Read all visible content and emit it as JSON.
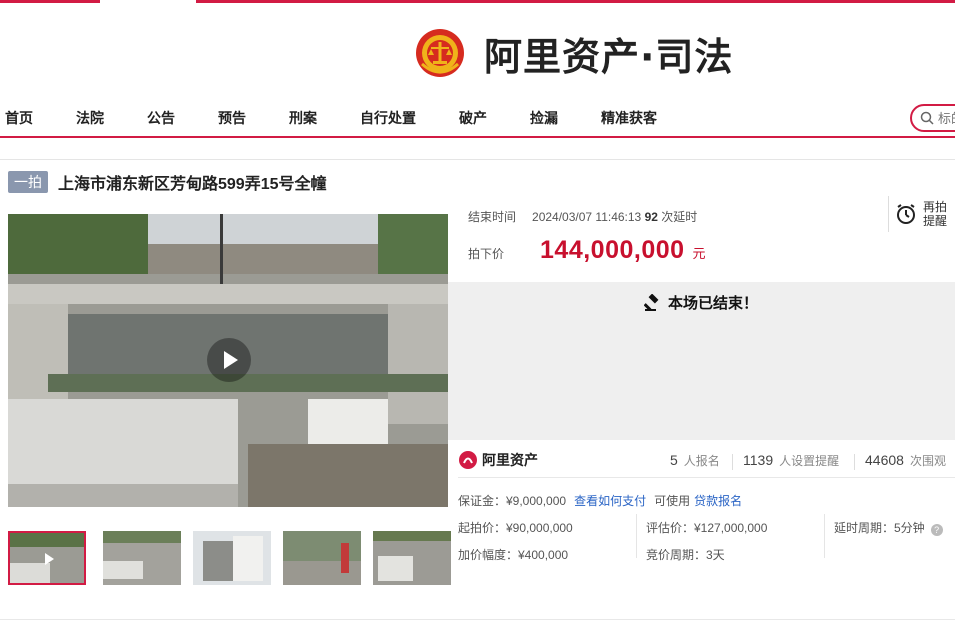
{
  "brand": {
    "name": "阿里资产·司法"
  },
  "nav": {
    "items": [
      "首页",
      "法院",
      "公告",
      "预告",
      "刑案",
      "自行处置",
      "破产",
      "捡漏",
      "精准获客"
    ],
    "search_placeholder": "标的"
  },
  "listing": {
    "tag": "一拍",
    "title": "上海市浦东新区芳甸路599弄15号全幢"
  },
  "auction": {
    "end_label": "结束时间",
    "end_time": "2024/03/07 11:46:13",
    "delay_count": "92",
    "delay_label": "次延时",
    "price_label": "拍下价",
    "price": "144,000,000",
    "price_unit": "元",
    "remind_line1": "再拍",
    "remind_line2": "提醒",
    "ended_text": "本场已结束！"
  },
  "stats": {
    "logo_text": "阿里资产",
    "signups": "5",
    "signups_label": "人报名",
    "reminders": "1139",
    "reminders_label": "人设置提醒",
    "views": "44608",
    "views_label": "次围观"
  },
  "deposit": {
    "text": "保证金：¥9,000,000",
    "how_to_pay": "查看如何支付",
    "usable": "可使用",
    "signup_link": "贷款报名"
  },
  "details": {
    "start_price": "起拍价：¥90,000,000",
    "increment": "加价幅度：¥400,000",
    "appraisal": "评估价：¥127,000,000",
    "bid_period": "竞价周期：3天",
    "delay_period": "延时周期：5分钟"
  },
  "colors": {
    "accent": "#d21b44",
    "price": "#c8102e",
    "link": "#2a64c5"
  }
}
